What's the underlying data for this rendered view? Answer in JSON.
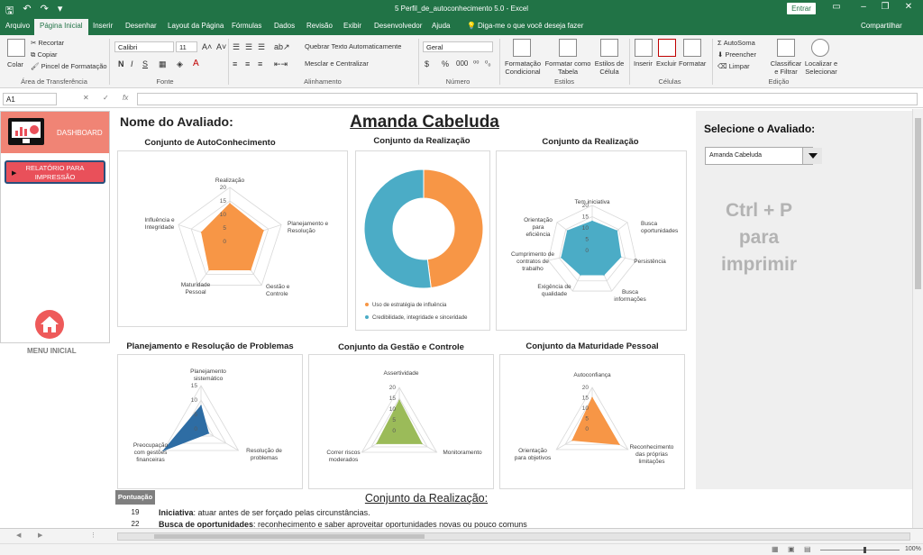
{
  "titlebar": {
    "doc_title": "5 Perfil_de_autoconhecimento 5.0  -  Excel",
    "login": "Entrar",
    "minimize": "–",
    "restore": "❐",
    "close": "✕"
  },
  "tabs": [
    "Arquivo",
    "Página Inicial",
    "Inserir",
    "Desenhar",
    "Layout da Página",
    "Fórmulas",
    "Dados",
    "Revisão",
    "Exibir",
    "Desenvolvedor",
    "Ajuda"
  ],
  "tell_me": "Diga-me o que você deseja fazer",
  "share": "Compartilhar",
  "ribbon": {
    "clipboard": {
      "paste": "Colar",
      "cut": "Recortar",
      "copy": "Copiar",
      "format_painter": "Pincel de Formatação",
      "label": "Área de Transferência"
    },
    "font": {
      "name": "Calibri",
      "size": "11",
      "bold": "N",
      "italic": "I",
      "underline": "S",
      "label": "Fonte"
    },
    "alignment": {
      "wrap": "Quebrar Texto Automaticamente",
      "merge": "Mesclar e Centralizar",
      "label": "Alinhamento"
    },
    "number": {
      "format": "Geral",
      "percent": "%",
      "thousands": "000",
      "label": "Número"
    },
    "styles": {
      "conditional": "Formatação Condicional",
      "table": "Formatar como Tabela",
      "cell": "Estilos de Célula",
      "label": "Estilos"
    },
    "cells": {
      "insert": "Inserir",
      "delete": "Excluir",
      "format": "Formatar",
      "label": "Células"
    },
    "editing": {
      "autosum": "AutoSoma",
      "fill": "Preencher",
      "clear": "Limpar",
      "sort": "Classificar e Filtrar",
      "find": "Localizar e Selecionar",
      "label": "Edição"
    }
  },
  "formula_bar": {
    "cell_ref": "A1",
    "fx": "fx",
    "cancel": "✕",
    "enter": "✓",
    "value": ""
  },
  "left_panel": {
    "dashboard": "DASHBOARD",
    "report_line1": "RELATÓRIO PARA",
    "report_line2": "IMPRESSÃO",
    "menu": "MENU INICIAL"
  },
  "header": {
    "nome_label": "Nome do Avaliado:",
    "avaliado": "Amanda Cabeluda"
  },
  "right_panel": {
    "select_label": "Selecione o Avaliado:",
    "selected": "Amanda Cabeluda",
    "hint_line1": "Ctrl + P",
    "hint_line2": "para",
    "hint_line3": "imprimir"
  },
  "chart_titles": [
    "Conjunto de AutoConhecimento",
    "Conjunto da Realização",
    "Conjunto da Realização",
    "Planejamento e Resolução de Problemas",
    "Conjunto da Gestão e Controle",
    "Conjunto da Maturidade Pessoal"
  ],
  "colors": {
    "orange": "#f79646",
    "teal": "#4bacc6",
    "blue": "#2e6da4",
    "green": "#9bbb59",
    "excel_green": "#217346",
    "dash_red": "#f08475"
  },
  "chart_data": [
    {
      "type": "radar",
      "title": "Conjunto de AutoConhecimento",
      "categories": [
        "Realização",
        "Planejamento e Resolução",
        "Gestão e Controle",
        "Maturidade Pessoal",
        "Influência e Integridade"
      ],
      "values": [
        14,
        13,
        13,
        13,
        11
      ],
      "rlim": [
        0,
        20
      ],
      "ticks": [
        "0",
        "5",
        "10",
        "15",
        "20"
      ],
      "color": "#f79646"
    },
    {
      "type": "pie",
      "title": "Conjunto da Realização",
      "series": [
        {
          "name": "Uso de estratégia de influência",
          "value": 48
        },
        {
          "name": "Credibilidade, integridade e sinceridade",
          "value": 52
        }
      ],
      "legend": "bottom"
    },
    {
      "type": "radar",
      "title": "Conjunto da Realização",
      "categories": [
        "Tem iniciativa",
        "Busca oportunidades",
        "Persistência",
        "Busca informações",
        "Exigência de qualidade",
        "Cumprimento de contratos de trabalho",
        "Orientação para eficiência"
      ],
      "values": [
        13,
        14,
        13,
        12,
        12,
        14,
        14
      ],
      "rlim": [
        0,
        20
      ],
      "ticks": [
        "0",
        "5",
        "10",
        "15",
        "20"
      ],
      "color": "#4bacc6"
    },
    {
      "type": "radar",
      "title": "Planejamento e Resolução de Problemas",
      "categories": [
        "Planejamento sistemático",
        "Resolução de problemas",
        "Preocupação com gestões financeiras"
      ],
      "values": [
        8,
        3,
        15
      ],
      "rlim": [
        0,
        15
      ],
      "ticks": [
        "0",
        "5",
        "10",
        "15"
      ],
      "color": "#2e6da4"
    },
    {
      "type": "radar",
      "title": "Conjunto da Gestão e Controle",
      "categories": [
        "Assertividade",
        "Monitoramento",
        "Correr riscos moderados"
      ],
      "values": [
        14,
        12,
        12
      ],
      "rlim": [
        0,
        20
      ],
      "ticks": [
        "0",
        "5",
        "10",
        "15",
        "20"
      ],
      "color": "#9bbb59"
    },
    {
      "type": "radar",
      "title": "Conjunto da Maturidade Pessoal",
      "categories": [
        "Autoconfiança",
        "Reconhecimento das próprias limitações",
        "Orientação para objetivos"
      ],
      "values": [
        15,
        15,
        11
      ],
      "rlim": [
        0,
        20
      ],
      "ticks": [
        "0",
        "5",
        "10",
        "15",
        "20"
      ],
      "color": "#f79646"
    }
  ],
  "bottom": {
    "pontuacao": "Pontuação",
    "title": "Conjunto da Realização:",
    "rows": [
      {
        "score": "19",
        "term": "Iniciativa",
        "desc": ": atuar antes de ser forçado pelas circunstâncias."
      },
      {
        "score": "22",
        "term": "Busca de oportunidades",
        "desc": ": reconhecimento e saber aproveitar oportunidades novas ou pouco comuns"
      }
    ]
  },
  "status": {
    "zoom": "100%"
  }
}
